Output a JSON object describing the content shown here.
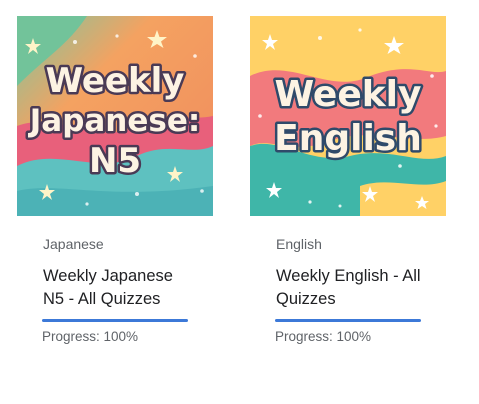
{
  "courses": [
    {
      "thumbnail_text": [
        "Weekly",
        "Japanese:",
        "N5"
      ],
      "category": "Japanese",
      "title": "Weekly Japanese N5 - All Quizzes",
      "progress_label": "Progress: 100%",
      "progress": 1.0
    },
    {
      "thumbnail_text": [
        "Weekly",
        "English"
      ],
      "category": "English",
      "title": "Weekly English - All Quizzes",
      "progress_label": "Progress: 100%",
      "progress": 1.0
    }
  ],
  "colors": {
    "accent": "#3c79d8",
    "thumb_text_fill": "#fdf3e3",
    "thumb_text_outline": "#4a3a55"
  }
}
